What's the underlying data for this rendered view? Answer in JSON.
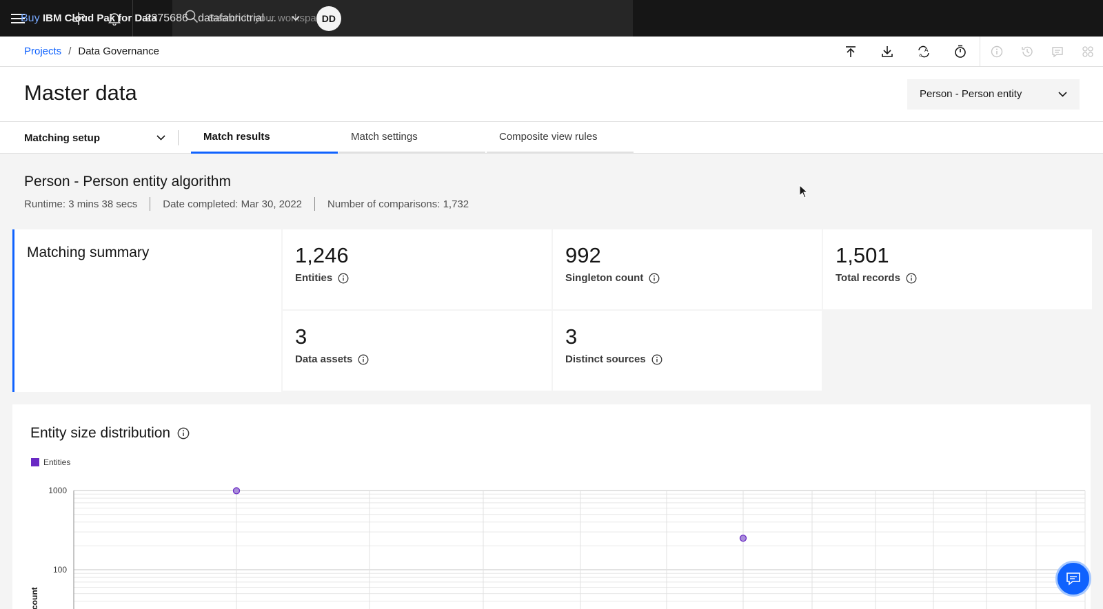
{
  "header": {
    "brand": "IBM Cloud Pak for Data",
    "search_placeholder": "Search in your workspaces",
    "buy_label": "Buy",
    "account_label": "2375686 - datafabrictrial ...",
    "avatar_initials": "DD"
  },
  "breadcrumb": {
    "items": [
      "Projects",
      "Data Governance"
    ],
    "separator": "/"
  },
  "page": {
    "title": "Master data",
    "entity_selector": "Person - Person entity"
  },
  "tabs": {
    "setup_dropdown": "Matching setup",
    "items": [
      "Match results",
      "Match settings",
      "Composite view rules"
    ],
    "active": "Match results"
  },
  "algorithm": {
    "title": "Person - Person entity algorithm",
    "runtime": "Runtime: 3 mins 38 secs",
    "date_completed": "Date completed: Mar 30, 2022",
    "comparisons": "Number of comparisons: 1,732"
  },
  "summary": {
    "title": "Matching summary",
    "stats": [
      {
        "value": "1,246",
        "label": "Entities"
      },
      {
        "value": "992",
        "label": "Singleton count"
      },
      {
        "value": "1,501",
        "label": "Total records"
      },
      {
        "value": "3",
        "label": "Data assets"
      },
      {
        "value": "3",
        "label": "Distinct sources"
      }
    ]
  },
  "chart_section": {
    "title": "Entity size distribution",
    "legend": "Entities"
  },
  "chart_data": {
    "type": "scatter",
    "title": "Entity size distribution",
    "ylabel": "count",
    "yscale": "log",
    "y_ticks": [
      1000,
      100
    ],
    "series": [
      {
        "name": "Entities",
        "points": [
          {
            "y": 992
          },
          {
            "y": 250
          }
        ]
      }
    ],
    "legend": "top-left",
    "grid": true,
    "color": "#6929c4"
  },
  "colors": {
    "accent": "#0f62fe",
    "header_bg": "#161616",
    "series": "#6929c4"
  }
}
